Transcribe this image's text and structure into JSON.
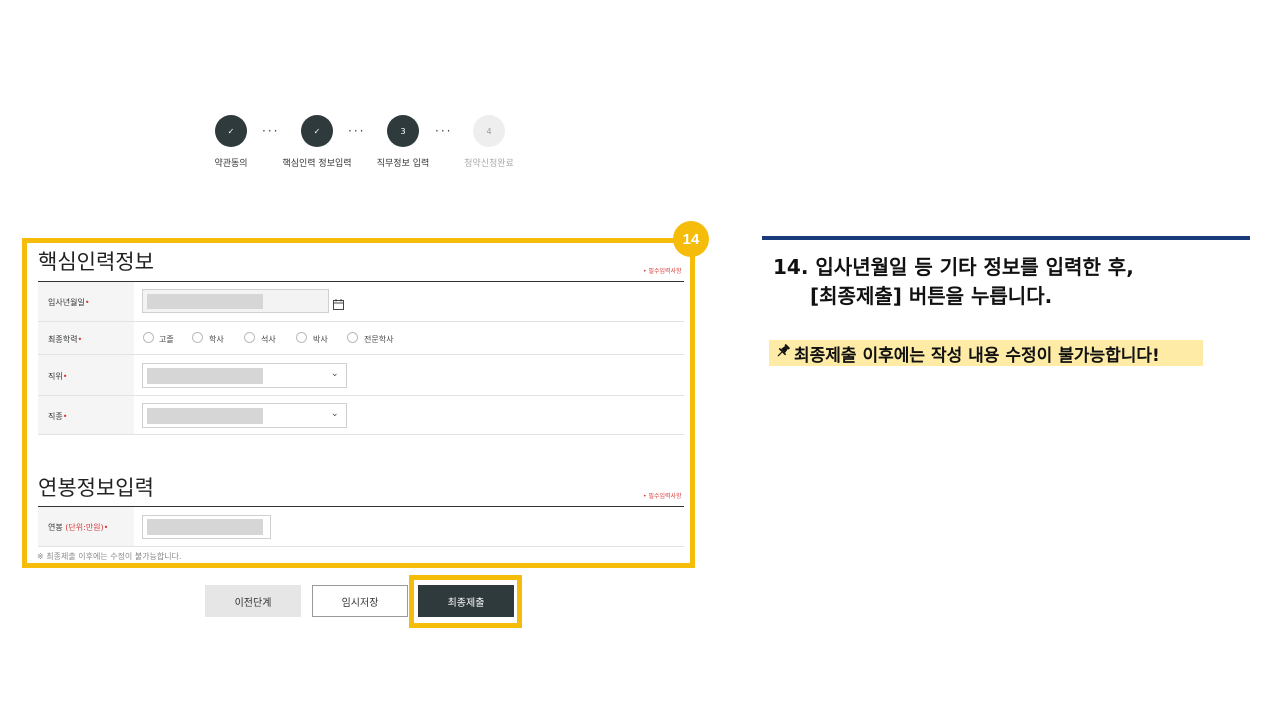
{
  "stepper": {
    "steps": [
      {
        "label": "약관동의",
        "marker": "✓",
        "state": "done"
      },
      {
        "label": "핵심인력 정보입력",
        "marker": "✓",
        "state": "done"
      },
      {
        "label": "직무정보 입력",
        "marker": "3",
        "state": "active"
      },
      {
        "label": "청약신청완료",
        "marker": "4",
        "state": "pending"
      }
    ],
    "dots": "···"
  },
  "badge": "14",
  "core_info": {
    "title": "핵심인력정보",
    "required_note": "• 필수입력사항",
    "rows": {
      "hire_date": {
        "label": "입사년월일",
        "req": "•"
      },
      "education": {
        "label": "최종학력",
        "req": "•",
        "options": [
          "고졸",
          "학사",
          "석사",
          "박사",
          "전문학사"
        ]
      },
      "position": {
        "label": "직위",
        "req": "•"
      },
      "job_type": {
        "label": "직종",
        "req": "•"
      }
    }
  },
  "salary_info": {
    "title": "연봉정보입력",
    "required_note": "• 필수입력사항",
    "row": {
      "label": "연봉",
      "unit": "(단위:만원)",
      "req": "•"
    },
    "footnote": "※ 최종제출 이후에는 수정이 불가능합니다."
  },
  "buttons": {
    "prev": "이전단계",
    "save": "임시저장",
    "submit": "최종제출"
  },
  "instruction": {
    "line1": "14. 입사년월일 등 기타 정보를 입력한 후,",
    "line2": "[최종제출] 버튼을 누릅니다.",
    "note": "최종제출 이후에는 작성 내용 수정이 불가능합니다!"
  },
  "colors": {
    "highlight": "#f5bd0a",
    "step_dark": "#2f3a3c",
    "rule_blue": "#1b3a7a",
    "note_bg": "#fdeba6",
    "required_red": "#d63a3a"
  }
}
